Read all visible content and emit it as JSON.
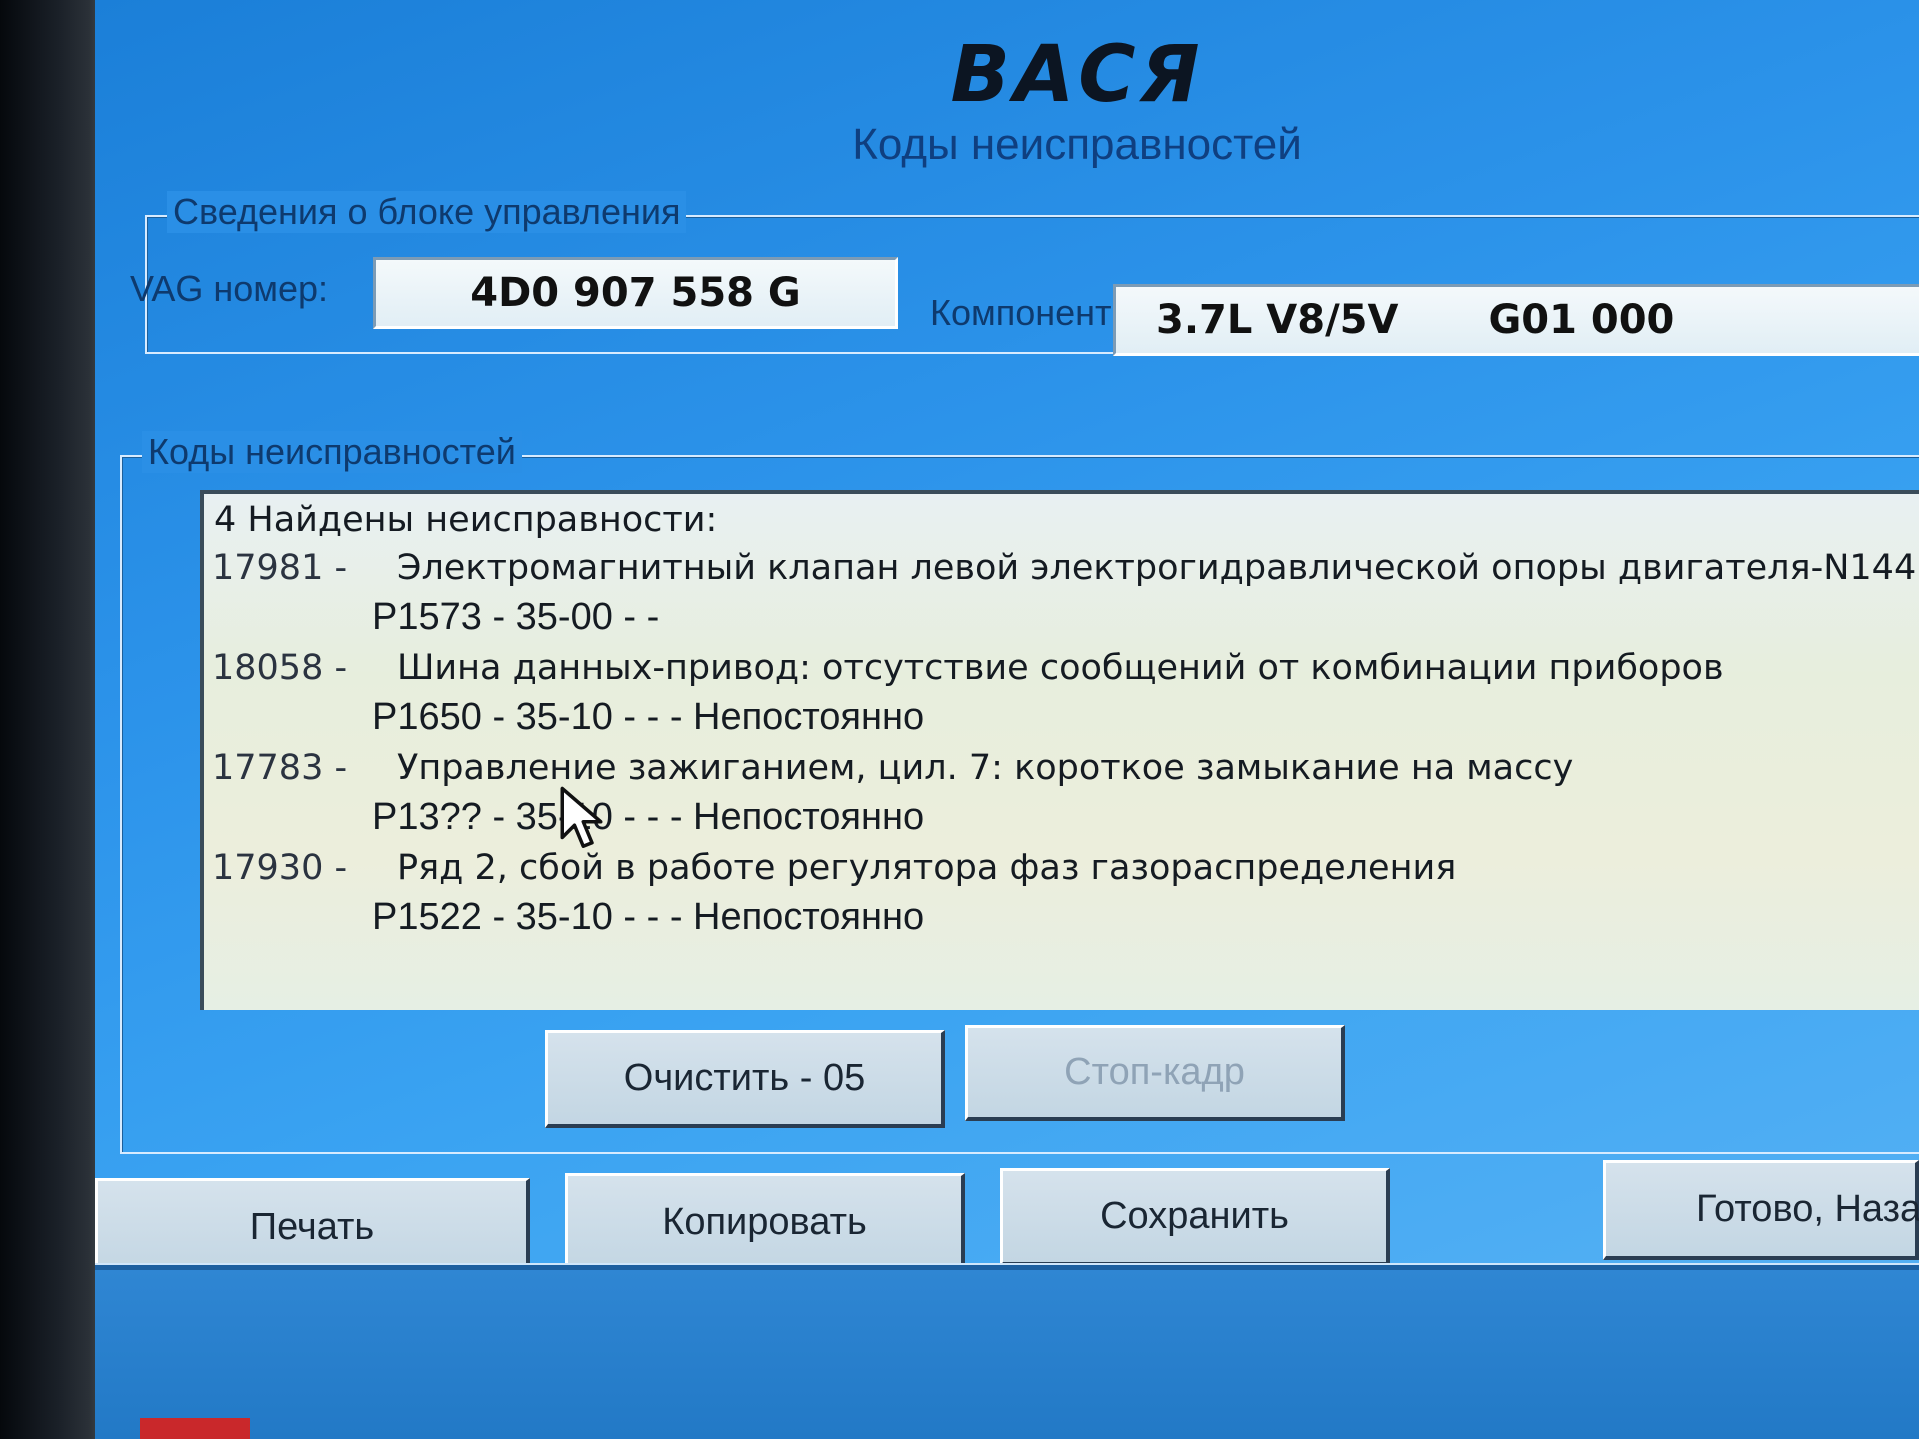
{
  "app": {
    "title": "ВАСЯ",
    "subtitle": "Коды неисправностей"
  },
  "control_unit": {
    "legend": "Сведения о блоке управления",
    "vag_label": "VAG номер:",
    "vag_number": "4D0 907 558 G",
    "component_label": "Компонент:",
    "component_value": "3.7L V8/5V",
    "component_extra": "G01 000"
  },
  "faults": {
    "legend": "Коды неисправностей",
    "header": "4 Найдены неисправности:",
    "items": [
      {
        "code": "17981 -",
        "description": "Электромагнитный клапан левой электрогидравлической опоры двигателя-N144:",
        "detail": "P1573 - 35-00 -   -"
      },
      {
        "code": "18058 -",
        "description": "Шина данных-привод: отсутствие сообщений от комбинации приборов",
        "detail": "P1650 - 35-10 -   - - Непостоянно"
      },
      {
        "code": "17783 -",
        "description": "Управление зажиганием, цил. 7: короткое замыкание на массу",
        "detail": "P13?? - 35-10 -   - - Непостоянно"
      },
      {
        "code": "17930 -",
        "description": "Ряд 2, сбой в работе регулятора фаз газораспределения",
        "detail": "P1522 - 35-10 -   - - Непостоянно"
      }
    ]
  },
  "buttons": {
    "clear": "Очистить - 05",
    "freeze_frame": "Стоп-кадр",
    "print": "Печать",
    "copy": "Копировать",
    "save": "Сохранить",
    "done": "Готово, Наза"
  }
}
